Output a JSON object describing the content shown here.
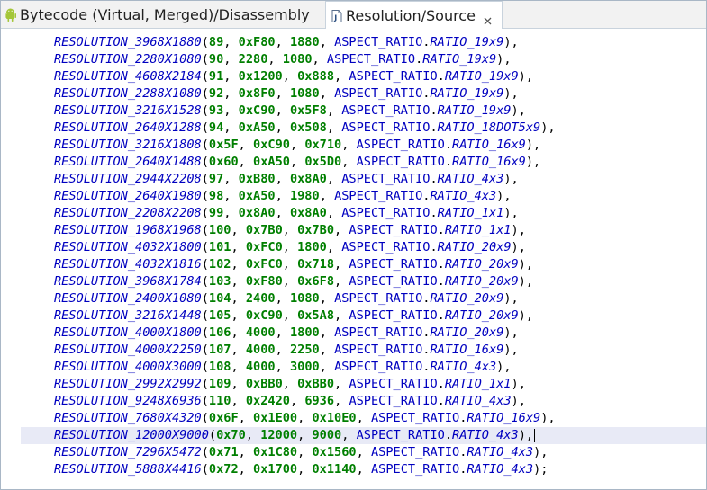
{
  "tabs": [
    {
      "label": "Bytecode (Virtual, Merged)/Disassembly",
      "icon": "android-icon",
      "active": false
    },
    {
      "label": "Resolution/Source",
      "icon": "java-file-icon",
      "active": true
    }
  ],
  "editor": {
    "prefix": "RESOLUTION_",
    "enum_ref": "ASPECT_RATIO",
    "current_line_index": 23,
    "lines": [
      {
        "name": "3968X1880",
        "a": "89",
        "b": "0xF80",
        "c": "1880",
        "ratio": "RATIO_19x9",
        "end": ","
      },
      {
        "name": "2280X1080",
        "a": "90",
        "b": "2280",
        "c": "1080",
        "ratio": "RATIO_19x9",
        "end": ","
      },
      {
        "name": "4608X2184",
        "a": "91",
        "b": "0x1200",
        "c": "0x888",
        "ratio": "RATIO_19x9",
        "end": ","
      },
      {
        "name": "2288X1080",
        "a": "92",
        "b": "0x8F0",
        "c": "1080",
        "ratio": "RATIO_19x9",
        "end": ","
      },
      {
        "name": "3216X1528",
        "a": "93",
        "b": "0xC90",
        "c": "0x5F8",
        "ratio": "RATIO_19x9",
        "end": ","
      },
      {
        "name": "2640X1288",
        "a": "94",
        "b": "0xA50",
        "c": "0x508",
        "ratio": "RATIO_18DOT5x9",
        "end": ","
      },
      {
        "name": "3216X1808",
        "a": "0x5F",
        "b": "0xC90",
        "c": "0x710",
        "ratio": "RATIO_16x9",
        "end": ","
      },
      {
        "name": "2640X1488",
        "a": "0x60",
        "b": "0xA50",
        "c": "0x5D0",
        "ratio": "RATIO_16x9",
        "end": ","
      },
      {
        "name": "2944X2208",
        "a": "97",
        "b": "0xB80",
        "c": "0x8A0",
        "ratio": "RATIO_4x3",
        "end": ","
      },
      {
        "name": "2640X1980",
        "a": "98",
        "b": "0xA50",
        "c": "1980",
        "ratio": "RATIO_4x3",
        "end": ","
      },
      {
        "name": "2208X2208",
        "a": "99",
        "b": "0x8A0",
        "c": "0x8A0",
        "ratio": "RATIO_1x1",
        "end": ","
      },
      {
        "name": "1968X1968",
        "a": "100",
        "b": "0x7B0",
        "c": "0x7B0",
        "ratio": "RATIO_1x1",
        "end": ","
      },
      {
        "name": "4032X1800",
        "a": "101",
        "b": "0xFC0",
        "c": "1800",
        "ratio": "RATIO_20x9",
        "end": ","
      },
      {
        "name": "4032X1816",
        "a": "102",
        "b": "0xFC0",
        "c": "0x718",
        "ratio": "RATIO_20x9",
        "end": ","
      },
      {
        "name": "3968X1784",
        "a": "103",
        "b": "0xF80",
        "c": "0x6F8",
        "ratio": "RATIO_20x9",
        "end": ","
      },
      {
        "name": "2400X1080",
        "a": "104",
        "b": "2400",
        "c": "1080",
        "ratio": "RATIO_20x9",
        "end": ","
      },
      {
        "name": "3216X1448",
        "a": "105",
        "b": "0xC90",
        "c": "0x5A8",
        "ratio": "RATIO_20x9",
        "end": ","
      },
      {
        "name": "4000X1800",
        "a": "106",
        "b": "4000",
        "c": "1800",
        "ratio": "RATIO_20x9",
        "end": ","
      },
      {
        "name": "4000X2250",
        "a": "107",
        "b": "4000",
        "c": "2250",
        "ratio": "RATIO_16x9",
        "end": ","
      },
      {
        "name": "4000X3000",
        "a": "108",
        "b": "4000",
        "c": "3000",
        "ratio": "RATIO_4x3",
        "end": ","
      },
      {
        "name": "2992X2992",
        "a": "109",
        "b": "0xBB0",
        "c": "0xBB0",
        "ratio": "RATIO_1x1",
        "end": ","
      },
      {
        "name": "9248X6936",
        "a": "110",
        "b": "0x2420",
        "c": "6936",
        "ratio": "RATIO_4x3",
        "end": ","
      },
      {
        "name": "7680X4320",
        "a": "0x6F",
        "b": "0x1E00",
        "c": "0x10E0",
        "ratio": "RATIO_16x9",
        "end": ","
      },
      {
        "name": "12000X9000",
        "a": "0x70",
        "b": "12000",
        "c": "9000",
        "ratio": "RATIO_4x3",
        "end": ","
      },
      {
        "name": "7296X5472",
        "a": "0x71",
        "b": "0x1C80",
        "c": "0x1560",
        "ratio": "RATIO_4x3",
        "end": ","
      },
      {
        "name": "5888X4416",
        "a": "0x72",
        "b": "0x1700",
        "c": "0x1140",
        "ratio": "RATIO_4x3",
        "end": ";"
      }
    ]
  },
  "colors": {
    "identifier": "#0000c0",
    "number": "#007f00",
    "current_line": "#e8eaf6",
    "border": "#a9b7c6"
  }
}
